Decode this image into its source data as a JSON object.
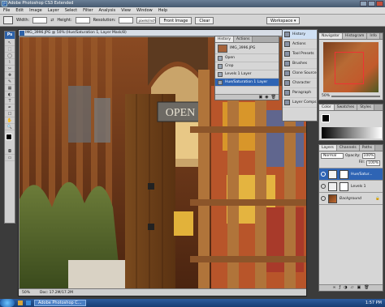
{
  "window": {
    "title": "Adobe Photoshop CS3 Extended"
  },
  "menu": [
    "File",
    "Edit",
    "Image",
    "Layer",
    "Select",
    "Filter",
    "Analysis",
    "View",
    "Window",
    "Help"
  ],
  "options": {
    "width_label": "Width:",
    "height_label": "Height:",
    "resolution_label": "Resolution:",
    "resolution_unit": "pixels/inch",
    "front_image_button": "Front Image",
    "clear_button": "Clear",
    "workspace_button": "Workspace ▾"
  },
  "toolbox": {
    "logo": "Ps",
    "tools": [
      "↖",
      "⬚",
      "◯",
      "⌇",
      "✂",
      "✚",
      "✎",
      "▦",
      "◐",
      "T",
      "✒",
      "☐",
      "✋",
      "🔍",
      "■"
    ]
  },
  "document": {
    "title": "IMG_3996.JPG @ 50% (Hue/Saturation 1, Layer Mask/8)",
    "zoom": "50%",
    "doc_info": "Doc: 17.2M/17.2M",
    "sign_text": "OPEN"
  },
  "history_panel": {
    "tabs": [
      "History",
      "Actions"
    ],
    "snapshot": "IMG_3996.JPG",
    "items": [
      "Open",
      "Crop",
      "Levels 1 Layer",
      "Hue/Saturation 1 Layer"
    ]
  },
  "dock": {
    "items": [
      "History",
      "Actions",
      "Tool Presets",
      "Brushes",
      "Clone Source",
      "Character",
      "Paragraph",
      "Layer Comps"
    ]
  },
  "navigator": {
    "tabs": [
      "Navigator",
      "Histogram",
      "Info"
    ],
    "zoom": "50%"
  },
  "color_panel": {
    "tabs": [
      "Color",
      "Swatches",
      "Styles"
    ]
  },
  "layers_panel": {
    "tabs": [
      "Layers",
      "Channels",
      "Paths"
    ],
    "blend": "Normal",
    "opacity_label": "Opacity:",
    "opacity": "100%",
    "fill_label": "Fill:",
    "fill": "100%",
    "layers": [
      "Hue/Satur...",
      "Levels 1",
      "Background"
    ]
  },
  "taskbar": {
    "app_button": "Adobe Photoshop C...",
    "clock": "1:57 PM"
  }
}
